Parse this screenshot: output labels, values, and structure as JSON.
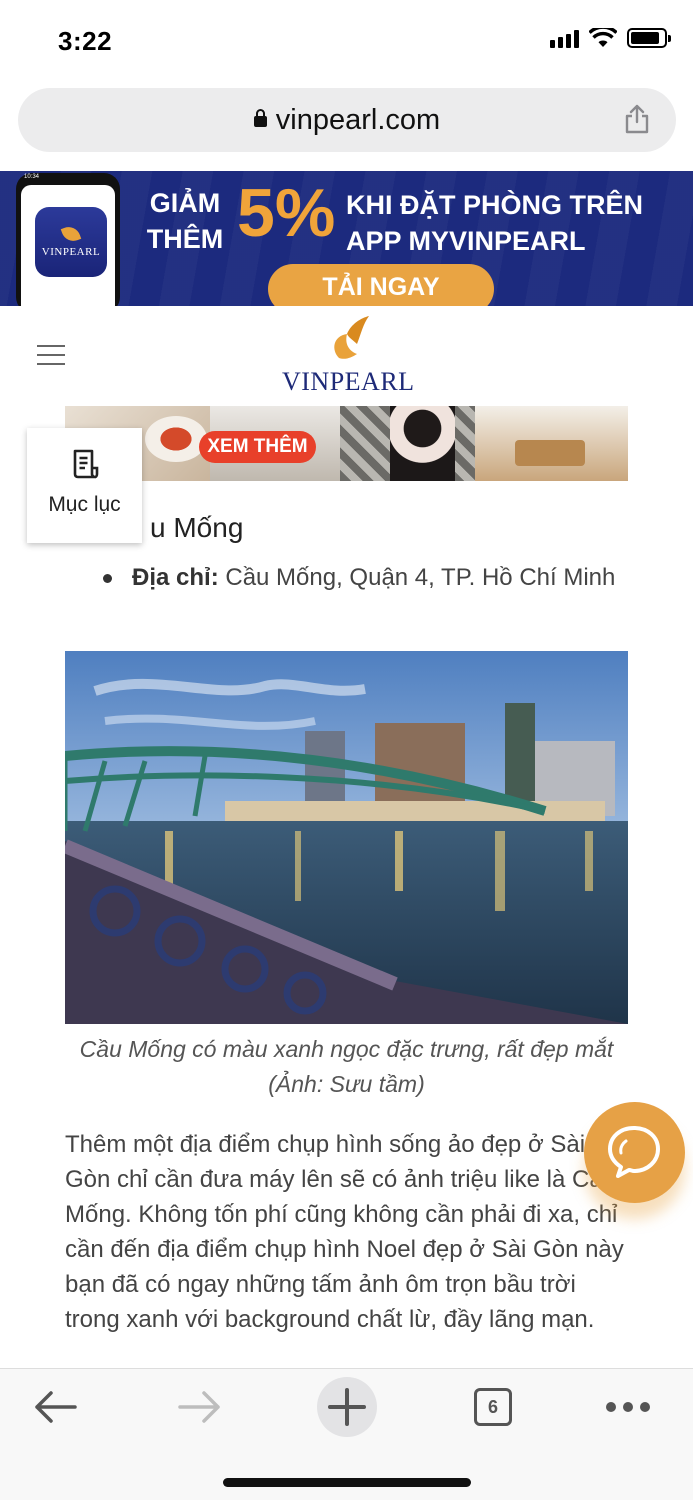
{
  "status_bar": {
    "time": "3:22"
  },
  "address_bar": {
    "url": "vinpearl.com"
  },
  "banner": {
    "line1_left": "GIẢM",
    "line2_left": "THÊM",
    "percent": "5%",
    "line1_right": "KHI ĐẶT PHÒNG TRÊN",
    "line2_right": "APP MYVINPEARL",
    "cta": "TẢI NGAY",
    "app_name": "VINPEARL",
    "phone_time": "10:34",
    "colors": {
      "background": "#1c2a7e",
      "accent": "#e9a443"
    }
  },
  "site_header": {
    "logo_text": "VINPEARL"
  },
  "promo_strip": {
    "button": "XEM THÊM"
  },
  "toc": {
    "label": "Mục lục"
  },
  "article": {
    "heading": "u Mống",
    "address_label": "Địa chỉ:",
    "address_value": "Cầu Mống, Quận 4, TP. Hồ Chí Minh",
    "image_caption": "Cầu Mống có màu xanh ngọc đặc trưng, rất đẹp mắt (Ảnh: Sưu tầm)",
    "body": "Thêm một địa điểm chụp hình sống ảo đẹp ở Sài Gòn chỉ cần đưa máy lên sẽ có ảnh triệu like là Cầu Mống. Không tốn phí cũng không cần phải đi xa, chỉ cần đến địa điểm chụp hình Noel đẹp ở Sài Gòn này bạn đã có ngay những tấm ảnh ôm trọn bầu trời trong xanh với background chất lừ, đầy lãng mạn."
  },
  "toolbar": {
    "tab_count": "6"
  },
  "icons": [
    "lock-icon",
    "share-icon",
    "hamburger-icon",
    "document-icon",
    "chat-icon",
    "back-arrow-icon",
    "forward-arrow-icon",
    "plus-icon",
    "tabs-icon",
    "more-icon"
  ]
}
